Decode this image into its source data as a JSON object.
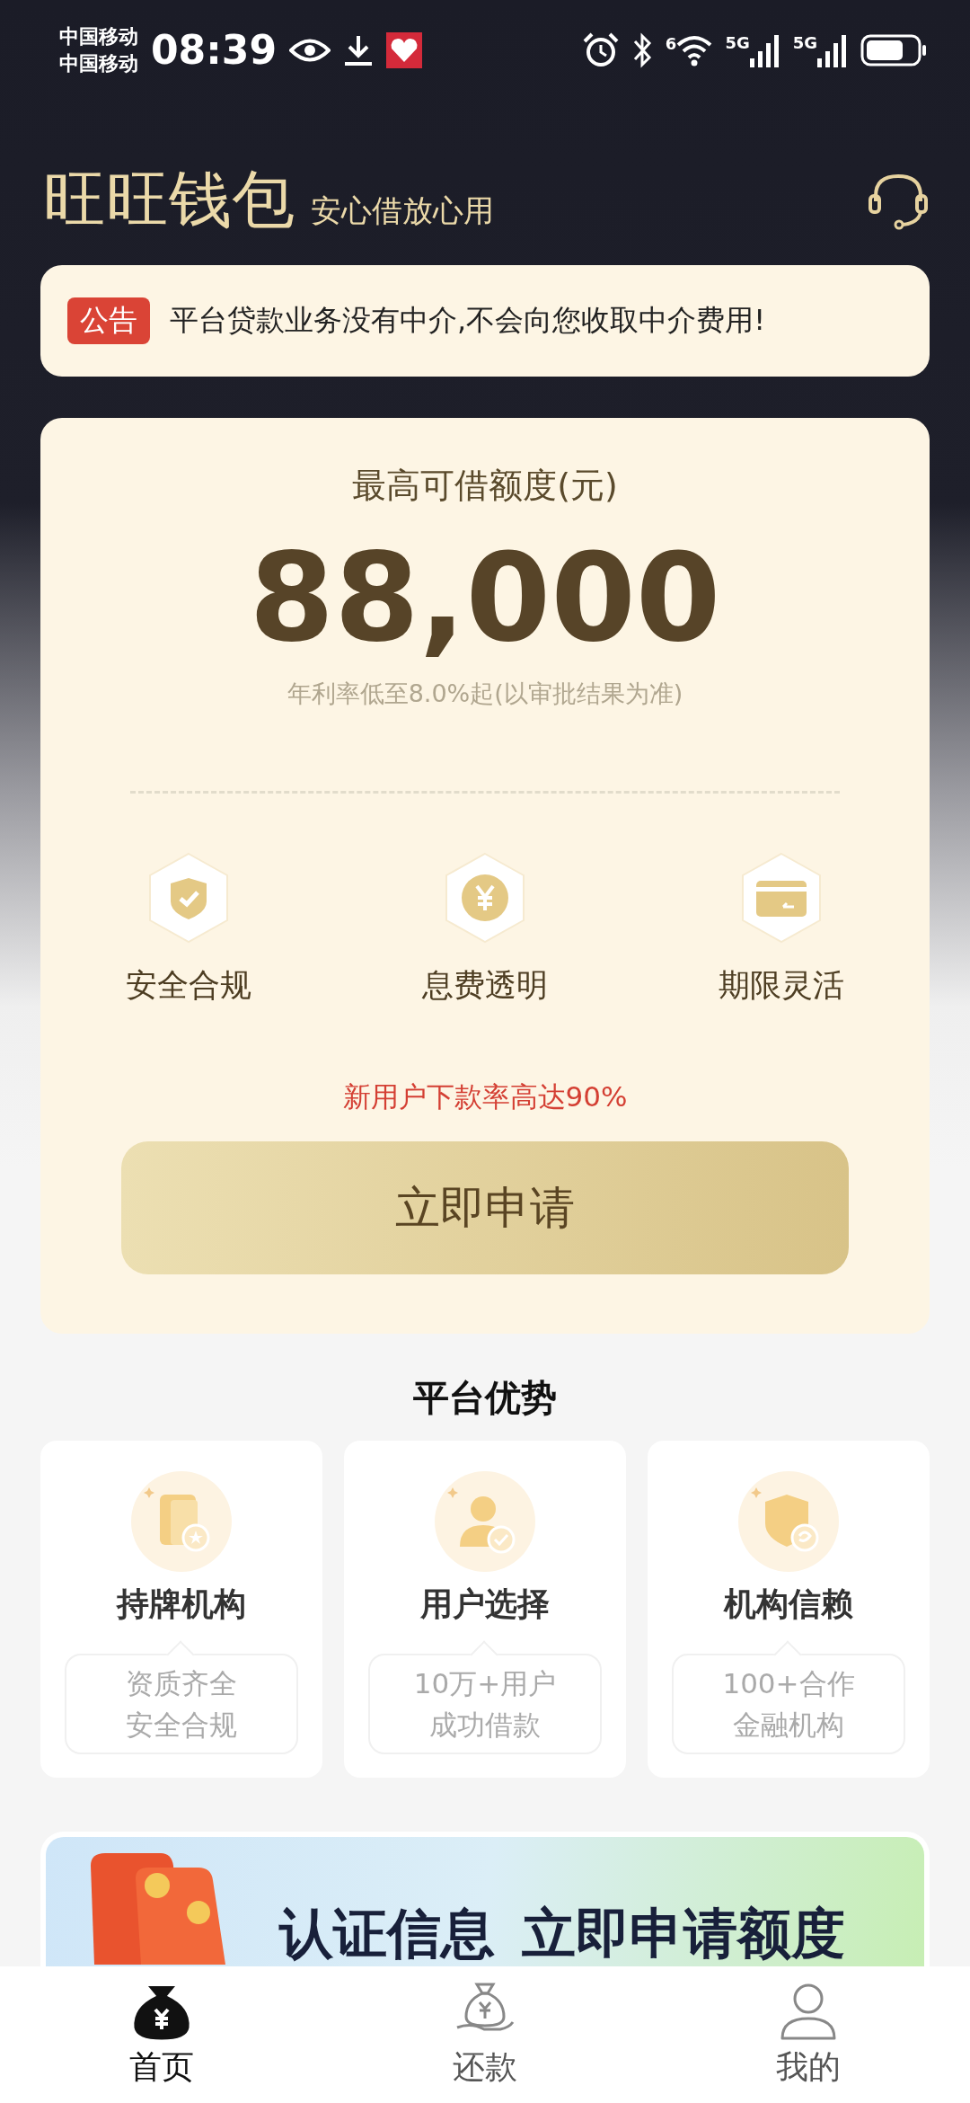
{
  "status_bar": {
    "carriers": [
      "中国移动",
      "中国移动"
    ],
    "time": "08:39",
    "wifi_label": "6",
    "network_labels": [
      "5G",
      "5G"
    ]
  },
  "header": {
    "title": "旺旺钱包",
    "slogan": "安心借放心用"
  },
  "notice": {
    "tag": "公告",
    "text": "平台贷款业务没有中介,不会向您收取中介费用!"
  },
  "loan_card": {
    "label": "最高可借额度(元)",
    "amount": "88,000",
    "rate_note": "年利率低至8.0%起(以审批结果为准)",
    "features": [
      {
        "kind": "shield",
        "label": "安全合规"
      },
      {
        "kind": "coin",
        "label": "息费透明"
      },
      {
        "kind": "card",
        "label": "期限灵活"
      }
    ],
    "promo": "新用户下款率高达90%",
    "apply_button": "立即申请"
  },
  "advantages": {
    "title": "平台优势",
    "items": [
      {
        "kind": "license",
        "title": "持牌机构",
        "lines": [
          "资质齐全",
          "安全合规"
        ]
      },
      {
        "kind": "user",
        "title": "用户选择",
        "lines": [
          "10万+用户",
          "成功借款"
        ]
      },
      {
        "kind": "trust",
        "title": "机构信赖",
        "lines": [
          "100+合作",
          "金融机构"
        ]
      }
    ]
  },
  "banner": {
    "texts": [
      "认证信息",
      "立即申请额度"
    ]
  },
  "tab_bar": [
    {
      "kind": "home",
      "label": "首页",
      "selected": true
    },
    {
      "kind": "repay",
      "label": "还款",
      "selected": false
    },
    {
      "kind": "profile",
      "label": "我的",
      "selected": false
    }
  ]
}
